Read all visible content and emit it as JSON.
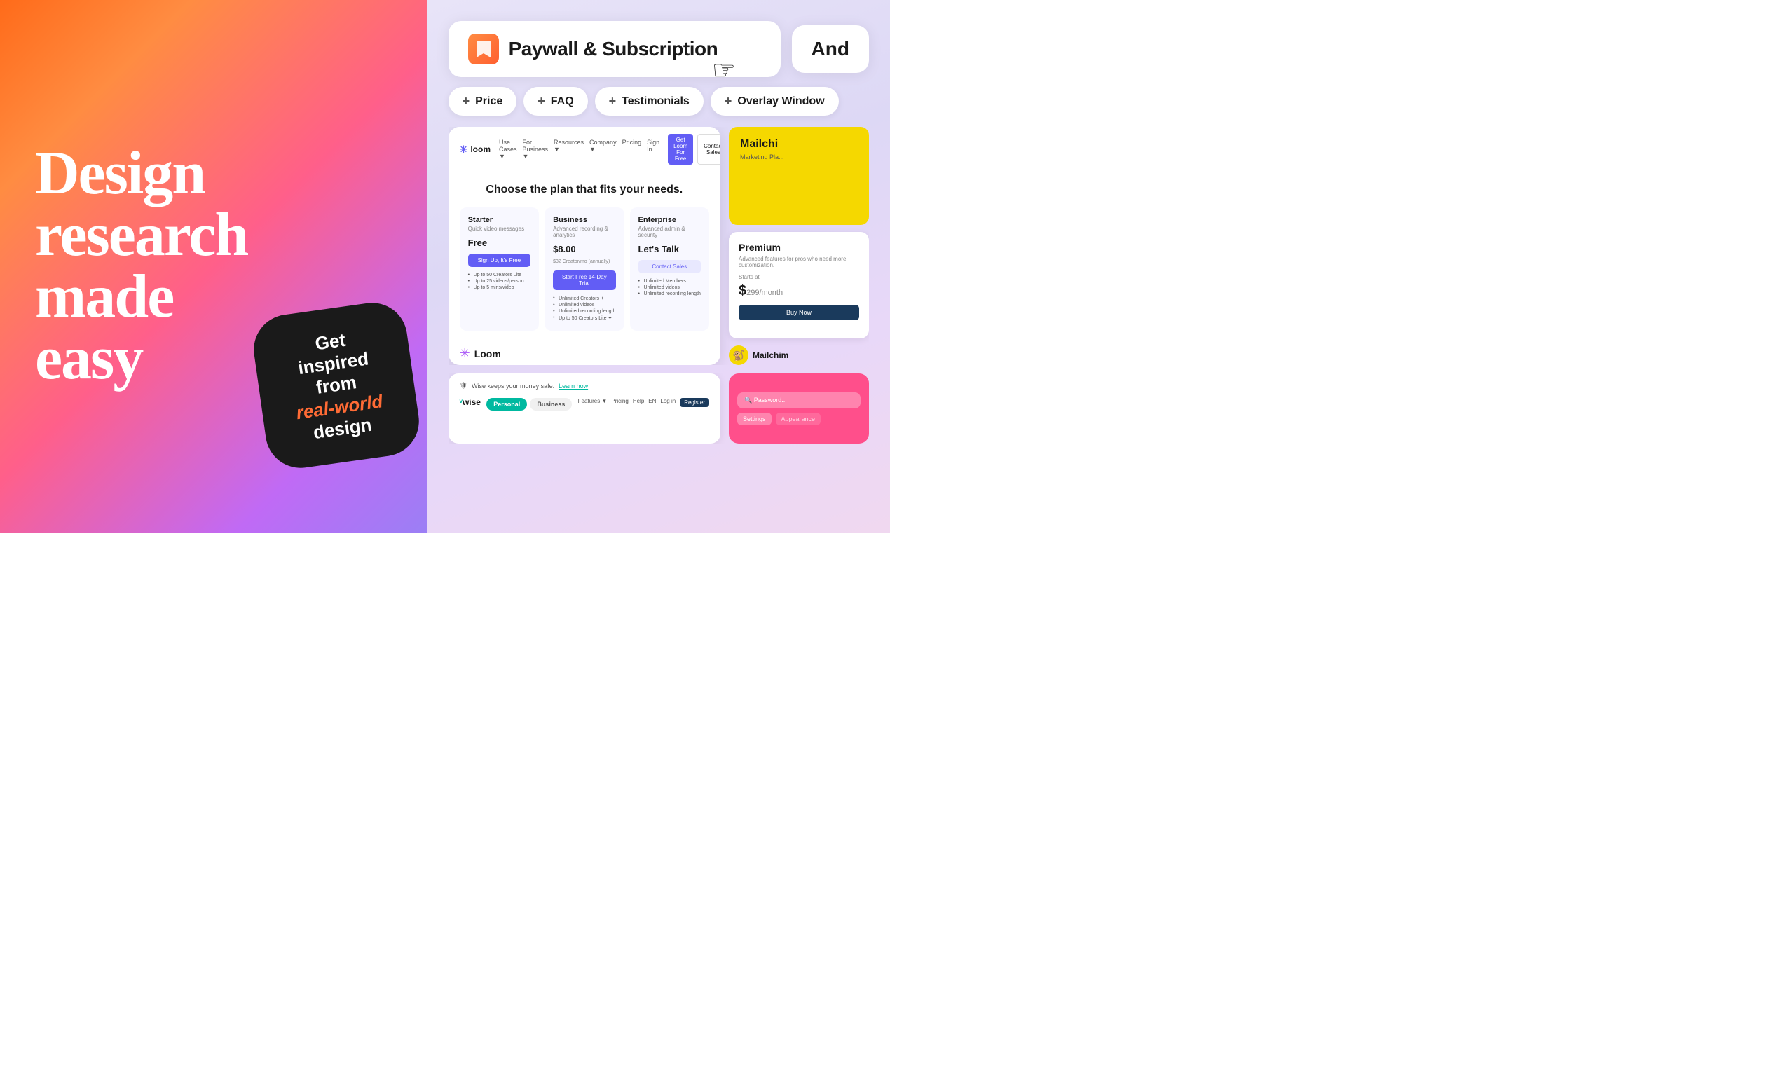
{
  "left": {
    "headline_line1": "Design",
    "headline_line2": "research",
    "headline_line3": "made",
    "headline_line4": "easy",
    "sticker": {
      "line1": "Get",
      "line2": "inspired",
      "line3": "from",
      "highlight": "real-world",
      "line4": "design"
    }
  },
  "right": {
    "paywall_title": "Paywall & Subscription",
    "and_text": "And",
    "cursor": "☞",
    "tags": [
      {
        "label": "Price"
      },
      {
        "label": "FAQ"
      },
      {
        "label": "Testimonials"
      },
      {
        "label": "Overlay Window"
      }
    ],
    "loom": {
      "logo": "loom",
      "nav_links": [
        "Use Cases ▼",
        "For Business ▼",
        "Resources ▼",
        "Company ▼",
        "Pricing",
        "Sign In"
      ],
      "btn1": "Get Loom For Free",
      "btn2": "Contact Sales",
      "heading": "Choose the plan that fits your needs.",
      "plans": [
        {
          "title": "Starter",
          "subtitle": "Quick video messages",
          "price": "Free",
          "btn_label": "Sign Up, It's Free",
          "btn_class": "btn-free",
          "features": [
            "Up to 50 Creators Lite",
            "Up to 25 videos/person",
            "Up to 5 mins/video"
          ]
        },
        {
          "title": "Business",
          "subtitle": "Advanced recording & analytics",
          "price": "$8.00",
          "price_note": "$32 Creator/mo (annually)",
          "btn_label": "Start Free 14-Day Trial",
          "btn_class": "btn-trial",
          "features": [
            "Unlimited Creators ✦",
            "Unlimited videos",
            "Unlimited recording length",
            "Up to 50 Creators Lite ✦"
          ]
        },
        {
          "title": "Enterprise",
          "subtitle": "Advanced admin & security",
          "price": "Let's Talk",
          "btn_label": "Contact Sales",
          "btn_class": "btn-contact",
          "features": [
            "Unlimited Members",
            "Unlimited videos",
            "Unlimited recording length"
          ]
        }
      ],
      "label": "Loom"
    },
    "mailchimp": {
      "title": "Mailchi",
      "subtitle": "Marketing Pla..."
    },
    "premium": {
      "title": "Premium",
      "subtitle": "Advanced features for pros who need more customization.",
      "starts_at": "Starts at",
      "price": "299",
      "price_period": "/month",
      "btn": "Buy Now"
    },
    "mailchimp2": {
      "label": "Mailchim"
    },
    "wise": {
      "logo": "wise",
      "safety_text": "Wise keeps your money safe.",
      "learn_more": "Learn how",
      "tabs": [
        "Personal",
        "Business"
      ],
      "nav_links": [
        "Features ▼",
        "Pricing",
        "Help",
        "EN",
        "Log in",
        "Register"
      ]
    }
  }
}
